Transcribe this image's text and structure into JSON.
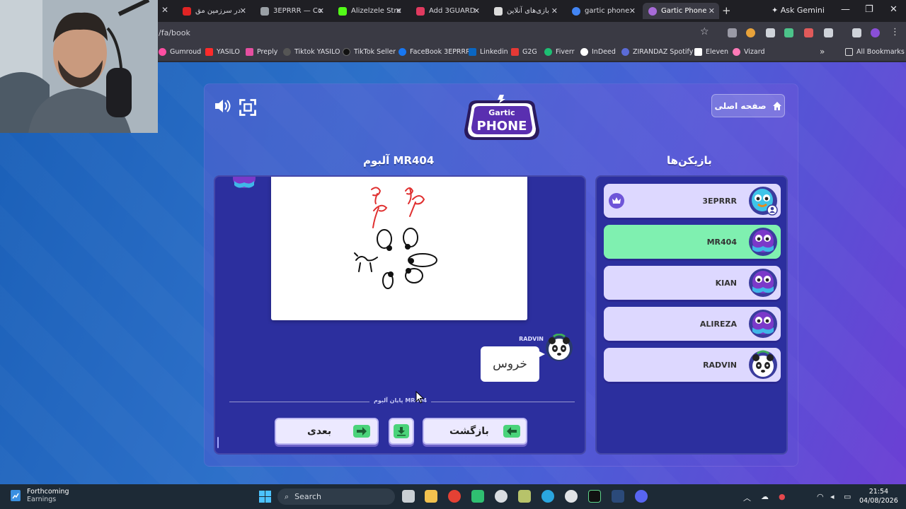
{
  "browser": {
    "tabs": [
      {
        "label": "در سرزمین مق",
        "color": "#e02424"
      },
      {
        "label": "3EPRRR — Co",
        "color": "#9aa0a6"
      },
      {
        "label": "Alizelzele Stre",
        "color": "#53fc18"
      },
      {
        "label": "Add 3GUARD",
        "color": "#e03a5f"
      },
      {
        "label": "بازی‌های آنلاین",
        "color": "#dcdcdc"
      },
      {
        "label": "gartic phone",
        "color": "#4285f4"
      },
      {
        "label": "Gartic Phone",
        "color": "#a76bd8"
      }
    ],
    "active_tab": "Gartic Phone",
    "ask_gemini": "Ask Gemini",
    "url": "/fa/book",
    "bookmarks": [
      {
        "label": "Gumroud",
        "color": "#ff4fa3"
      },
      {
        "label": "YASILO",
        "color": "#ff2b2b"
      },
      {
        "label": "Preply",
        "color": "#e54fa0"
      },
      {
        "label": "Tiktok YASILO",
        "color": "#333333"
      },
      {
        "label": "TikTok Seller",
        "color": "#111111"
      },
      {
        "label": "FaceBook 3EPRRR",
        "color": "#1877f2"
      },
      {
        "label": "Linkedin",
        "color": "#0a66c2"
      },
      {
        "label": "G2G",
        "color": "#e53935"
      },
      {
        "label": "Fiverr",
        "color": "#1dbf73"
      },
      {
        "label": "InDeed",
        "color": "#ffffff"
      },
      {
        "label": "ZIRANDAZ Spotify",
        "color": "#5b6bd6"
      },
      {
        "label": "Eleven",
        "color": "#ffffff"
      },
      {
        "label": "Vizard",
        "color": "#ff7ab8"
      }
    ],
    "all_bookmarks": "All Bookmarks"
  },
  "game": {
    "home_button": "صفحه اصلی",
    "logo_line1": "Gartic",
    "logo_line2": "PHONE",
    "album_title": "آلبوم MR404",
    "players_title": "بازیکن‌ها",
    "guess_author": "RADVIN",
    "guess_text": "خروس",
    "album_end_label": "پایان آلبوم MR404",
    "back_button": "بازگشت",
    "next_button": "بعدی",
    "players": [
      {
        "name": "3EPRRR",
        "host": true,
        "active": false,
        "avatar": "blue"
      },
      {
        "name": "MR404",
        "host": false,
        "active": true,
        "avatar": "purple"
      },
      {
        "name": "KIAN",
        "host": false,
        "active": false,
        "avatar": "purple"
      },
      {
        "name": "ALIREZA",
        "host": false,
        "active": false,
        "avatar": "purple"
      },
      {
        "name": "RADVIN",
        "host": false,
        "active": false,
        "avatar": "panda"
      }
    ]
  },
  "taskbar": {
    "news_title": "Forthcoming",
    "news_subtitle": "Earnings",
    "search_label": "Search",
    "time": "21:54",
    "date": "04/08/2026"
  }
}
